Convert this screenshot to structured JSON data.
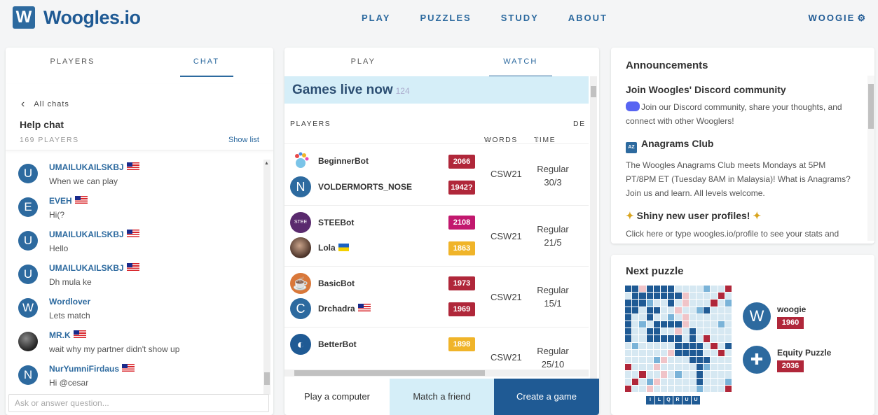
{
  "brand": {
    "logo_letter": "W",
    "name": "Woogles.io"
  },
  "nav": [
    "PLAY",
    "PUZZLES",
    "STUDY",
    "ABOUT"
  ],
  "user": {
    "name": "WOOGIE",
    "icon": "gear-icon"
  },
  "left_panel": {
    "tabs": [
      "PLAYERS",
      "CHAT"
    ],
    "active_tab": "CHAT",
    "back_label": "All chats",
    "chat_title": "Help chat",
    "player_count": "169 PLAYERS",
    "show_list": "Show list",
    "messages": [
      {
        "initial": "U",
        "name": "UMAILUKAILSKBJ",
        "flag": "MY",
        "text": "When we can play"
      },
      {
        "initial": "E",
        "name": "EVEH",
        "flag": "MY",
        "text": "Hi(?"
      },
      {
        "initial": "U",
        "name": "UMAILUKAILSKBJ",
        "flag": "MY",
        "text": "Hello"
      },
      {
        "initial": "U",
        "name": "UMAILUKAILSKBJ",
        "flag": "MY",
        "text": "Dh mula ke"
      },
      {
        "initial": "W",
        "name": "Wordlover",
        "flag": "",
        "text": "Lets match"
      },
      {
        "initial": "",
        "name": "MR.K",
        "flag": "MY",
        "text": "wait why my partner didn't show up"
      },
      {
        "initial": "N",
        "name": "NurYumniFirdaus",
        "flag": "MY",
        "text": "Hi @cesar"
      }
    ],
    "input_placeholder": "Ask or answer question..."
  },
  "center_panel": {
    "tabs": [
      "PLAY",
      "WATCH"
    ],
    "active_tab": "WATCH",
    "live_title": "Games live now",
    "live_count": "124",
    "columns": {
      "players": "PLAYERS",
      "words": "WORDS",
      "time": "TIME",
      "details": "DE"
    },
    "games": [
      {
        "p1": "BeginnerBot",
        "p1_rating": "2066",
        "p1_color": "#b0273a",
        "p2": "VOLDERMORTS_NOSE",
        "p2_initial": "N",
        "p2_rating": "1942?",
        "p2_color": "#b0273a",
        "lexicon": "CSW21",
        "time_type": "Regular",
        "time": "30/3"
      },
      {
        "p1": "STEEBot",
        "p1_rating": "2108",
        "p1_color": "#c2186e",
        "p2": "Lola",
        "p2_flag": "UA",
        "p2_rating": "1863",
        "p2_color": "#f0b429",
        "lexicon": "CSW21",
        "time_type": "Regular",
        "time": "21/5"
      },
      {
        "p1": "BasicBot",
        "p1_rating": "1973",
        "p1_color": "#b0273a",
        "p2": "Drchadra",
        "p2_initial": "C",
        "p2_flag": "MY",
        "p2_rating": "1969",
        "p2_color": "#b0273a",
        "lexicon": "CSW21",
        "time_type": "Regular",
        "time": "15/1"
      },
      {
        "p1": "BetterBot",
        "p1_rating": "1898",
        "p1_color": "#f0b429",
        "lexicon": "CSW21",
        "time_type": "Regular",
        "time": "25/10"
      }
    ],
    "buttons": [
      "Play a computer",
      "Match a friend",
      "Create a game"
    ]
  },
  "announcements": {
    "title": "Announcements",
    "items": [
      {
        "heading": "Join Woogles' Discord community",
        "body": "Join our Discord community, share your thoughts, and connect with other Wooglers!"
      },
      {
        "heading": "Anagrams Club",
        "body": "The Woogles Anagrams Club meets Mondays at 5PM PT/8PM ET (Tuesday 8AM in Malaysia)! What is Anagrams? Join us and learn. All levels welcome."
      },
      {
        "heading": "Shiny new user profiles!",
        "body": "Click here or type woogles.io/profile to see your stats and"
      }
    ]
  },
  "puzzle": {
    "title": "Next puzzle",
    "rack": [
      "I",
      "L",
      "Q",
      "R",
      "U",
      "U"
    ],
    "players": [
      {
        "initial": "W",
        "name": "woogie",
        "rating": "1960"
      },
      {
        "initial": "✚",
        "name": "Equity Puzzle",
        "rating": "2036"
      }
    ]
  },
  "colors": {
    "brand": "#1f5a94",
    "accent": "#2d6a9f",
    "live_banner": "#d5eef8"
  }
}
